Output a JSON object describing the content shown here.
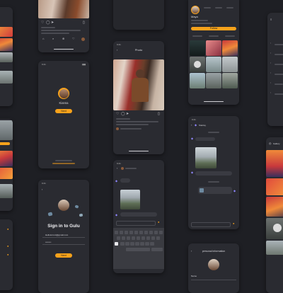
{
  "photo_screen": {
    "title": "Photo"
  },
  "profile_mini": {
    "name": "Kianna",
    "button": "Next"
  },
  "signin": {
    "title": "Sign in to Gulu",
    "email": "Hellotorrent@gmail.com",
    "password": "••••••••",
    "button": "Next"
  },
  "profile": {
    "name": "Maya",
    "button": "Follow"
  },
  "personal_info": {
    "title": "personal information",
    "name_label": "Name"
  },
  "chat": {
    "title": "Stanley"
  },
  "gallery": {
    "title": "Gallery"
  },
  "settings": {
    "items": [
      "",
      "",
      "",
      "",
      "",
      "",
      "",
      ""
    ]
  },
  "keyboard": {
    "rows": [
      "QWERTYUIOP",
      "ASDFGHJKL",
      "ZXCVBNM"
    ],
    "space": "space",
    "return": "return"
  },
  "colors": {
    "bg": "#1e1f24",
    "card": "#2a2b31",
    "accent": "#f7a21b",
    "bubble": "#3a3b42"
  }
}
